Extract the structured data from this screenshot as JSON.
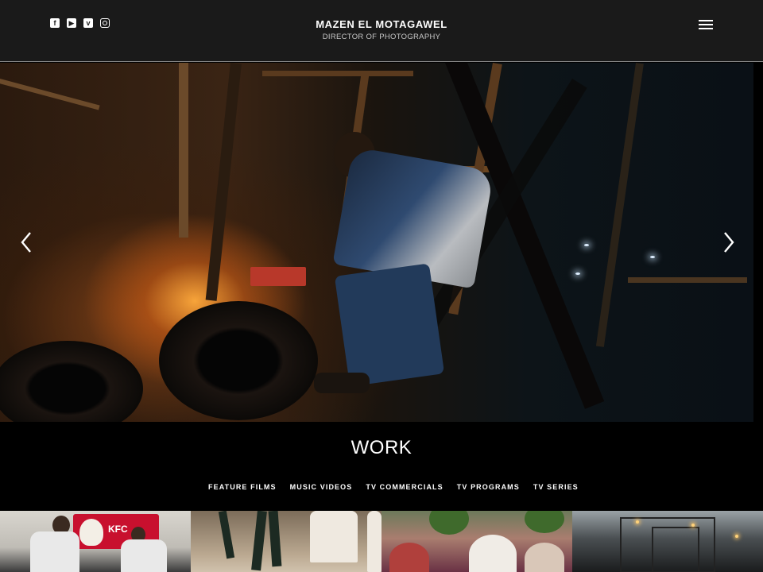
{
  "header": {
    "brand_name": "MAZEN EL MOTAGAWEL",
    "brand_subtitle": "DIRECTOR OF PHOTOGRAPHY",
    "social_icons": [
      "facebook-icon",
      "youtube-icon",
      "vimeo-icon",
      "instagram-icon"
    ],
    "menu_icon": "hamburger-menu-icon"
  },
  "hero": {
    "prev_icon": "chevron-left-icon",
    "next_icon": "chevron-right-icon"
  },
  "work": {
    "title": "WORK",
    "filters": [
      "FEATURE FILMS",
      "MUSIC VIDEOS",
      "TV COMMERCIALS",
      "TV PROGRAMS",
      "TV SERIES"
    ]
  },
  "thumbnails": {
    "sign_text": "KFC"
  },
  "colors": {
    "header_bg": "#1a1a1a",
    "page_bg": "#000000",
    "text": "#ffffff",
    "kfc_red": "#c8102e"
  }
}
